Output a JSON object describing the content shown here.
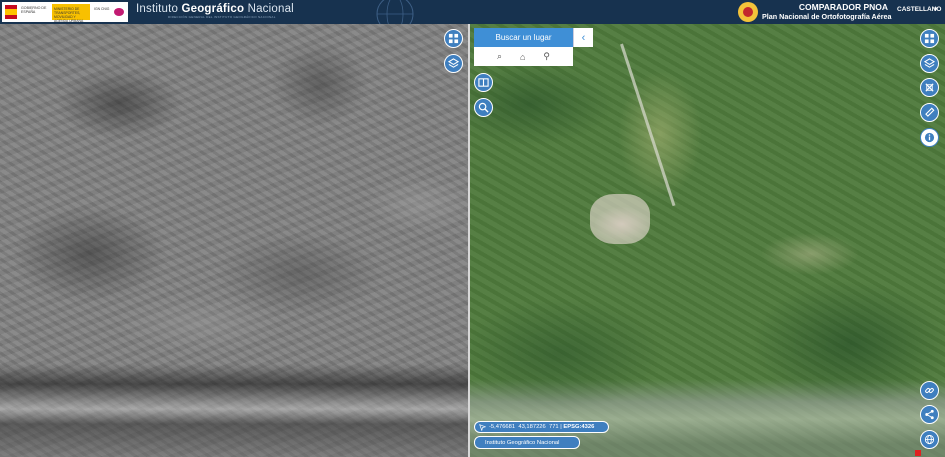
{
  "header": {
    "gov_logo": {
      "ministry_text": "GOBIERNO DE ESPAÑA",
      "band_text": "MINISTERIO DE TRANSPORTES, MOVILIDAD Y AGENDA URBANA",
      "agency_text": "IGN CNIG",
      "flag_icon": "spain-flag-icon"
    },
    "site_title_prefix": "Instituto ",
    "site_title_bold": "Geográfico",
    "site_title_suffix": " Nacional",
    "site_subtitle": "DIRECCIÓN GENERAL DEL INSTITUTO GEOGRÁFICO NACIONAL",
    "app_title": "COMPARADOR PNOA",
    "app_subtitle": "Plan Nacional de Ortofotografía Aérea",
    "language": "CASTELLANO",
    "language_caret": "▾"
  },
  "left_map": {
    "controls": [
      {
        "icon": "compare-grid-icon"
      },
      {
        "icon": "layers-icon"
      }
    ]
  },
  "center_controls": [
    {
      "icon": "layer-switch-icon"
    },
    {
      "icon": "zoom-icon"
    }
  ],
  "search": {
    "label": "Buscar un lugar",
    "tools": [
      {
        "icon": "zoom-search-icon",
        "glyph": "⌕"
      },
      {
        "icon": "home-search-icon",
        "glyph": "⌂"
      },
      {
        "icon": "location-icon",
        "glyph": "⚲"
      }
    ],
    "collapse_glyph": "‹"
  },
  "right_map": {
    "controls": [
      {
        "icon": "compare-grid-icon"
      },
      {
        "icon": "layers-icon"
      },
      {
        "icon": "crosshair-icon"
      },
      {
        "icon": "measure-ruler-icon"
      },
      {
        "icon": "info-icon"
      }
    ],
    "bottom_controls": [
      {
        "icon": "link-icon"
      },
      {
        "icon": "share-icon"
      },
      {
        "icon": "globe-icon"
      }
    ]
  },
  "coordinates": {
    "longitude": "-5,476681",
    "latitude": "43,187226",
    "scale": "771",
    "crs": "EPSG:4326"
  },
  "attribution": "Instituto Geográfico Nacional",
  "colors": {
    "header_bg": "#17324f",
    "button_blue": "#3f7fbf",
    "search_blue": "#3f8fd6"
  }
}
